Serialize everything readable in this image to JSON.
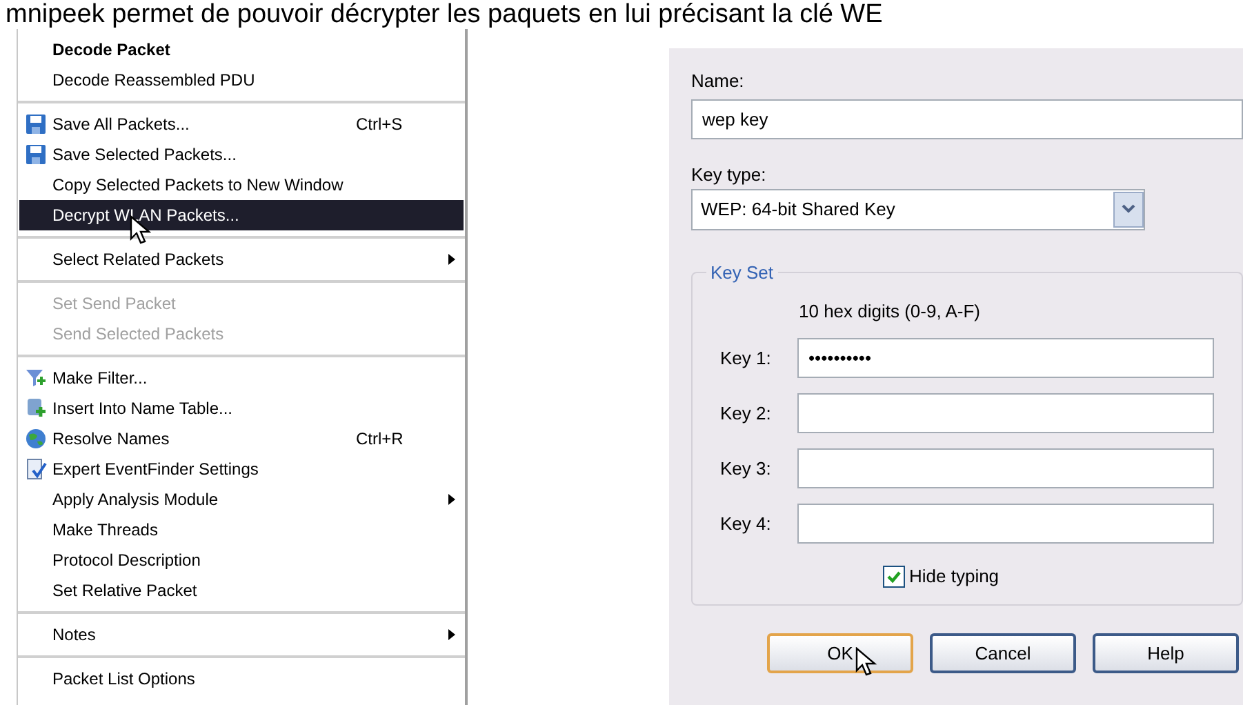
{
  "caption": "mnipeek permet de pouvoir décrypter les paquets en lui précisant la clé WE",
  "menu": [
    {
      "kind": "item",
      "label": "Decode Packet",
      "bold": true,
      "disabled": false,
      "selected": false,
      "submenu": false,
      "cursor": false
    },
    {
      "kind": "item",
      "label": "Decode Reassembled PDU",
      "bold": false,
      "disabled": false,
      "selected": false,
      "submenu": false,
      "cursor": false
    },
    {
      "kind": "separator"
    },
    {
      "kind": "item",
      "label": "Save All Packets...",
      "shortcut": "Ctrl+S",
      "bold": false,
      "disabled": false,
      "selected": false,
      "submenu": false,
      "cursor": false
    },
    {
      "kind": "item",
      "label": "Save Selected Packets...",
      "bold": false,
      "disabled": false,
      "selected": false,
      "submenu": false,
      "cursor": false
    },
    {
      "kind": "item",
      "label": "Copy Selected Packets to New Window",
      "bold": false,
      "disabled": false,
      "selected": false,
      "submenu": false,
      "cursor": false
    },
    {
      "kind": "item",
      "label": "Decrypt WLAN Packets...",
      "bold": false,
      "disabled": false,
      "selected": true,
      "submenu": false,
      "cursor": true
    },
    {
      "kind": "separator"
    },
    {
      "kind": "item",
      "label": "Select Related Packets",
      "bold": false,
      "disabled": false,
      "selected": false,
      "submenu": true,
      "cursor": false
    },
    {
      "kind": "separator"
    },
    {
      "kind": "item",
      "label": "Set Send Packet",
      "bold": false,
      "disabled": true,
      "selected": false,
      "submenu": false,
      "cursor": false
    },
    {
      "kind": "item",
      "label": "Send Selected Packets",
      "bold": false,
      "disabled": true,
      "selected": false,
      "submenu": false,
      "cursor": false
    },
    {
      "kind": "separator"
    },
    {
      "kind": "item",
      "label": "Make Filter...",
      "bold": false,
      "disabled": false,
      "selected": false,
      "submenu": false,
      "cursor": false
    },
    {
      "kind": "item",
      "label": "Insert Into Name Table...",
      "bold": false,
      "disabled": false,
      "selected": false,
      "submenu": false,
      "cursor": false
    },
    {
      "kind": "item",
      "label": "Resolve Names",
      "shortcut": "Ctrl+R",
      "bold": false,
      "disabled": false,
      "selected": false,
      "submenu": false,
      "cursor": false
    },
    {
      "kind": "item",
      "label": "Expert EventFinder Settings",
      "bold": false,
      "disabled": false,
      "selected": false,
      "submenu": false,
      "cursor": false
    },
    {
      "kind": "item",
      "label": "Apply Analysis Module",
      "bold": false,
      "disabled": false,
      "selected": false,
      "submenu": true,
      "cursor": false
    },
    {
      "kind": "item",
      "label": "Make Threads",
      "bold": false,
      "disabled": false,
      "selected": false,
      "submenu": false,
      "cursor": false
    },
    {
      "kind": "item",
      "label": "Protocol Description",
      "bold": false,
      "disabled": false,
      "selected": false,
      "submenu": false,
      "cursor": false
    },
    {
      "kind": "item",
      "label": "Set Relative Packet",
      "bold": false,
      "disabled": false,
      "selected": false,
      "submenu": false,
      "cursor": false
    },
    {
      "kind": "separator"
    },
    {
      "kind": "item",
      "label": "Notes",
      "bold": false,
      "disabled": false,
      "selected": false,
      "submenu": true,
      "cursor": false
    },
    {
      "kind": "separator"
    },
    {
      "kind": "item",
      "label": "Packet List Options",
      "bold": false,
      "disabled": false,
      "selected": false,
      "submenu": false,
      "cursor": false
    }
  ],
  "dialog": {
    "name_label": "Name:",
    "name_value": "wep key",
    "key_type_label": "Key type:",
    "key_type_value": "WEP: 64-bit Shared Key",
    "group_title": "Key Set",
    "hint": "10 hex digits (0-9, A-F)",
    "keys": [
      {
        "label": "Key 1:",
        "value": "••••••••••"
      },
      {
        "label": "Key 2:"
      },
      {
        "label": "Key 3:"
      },
      {
        "label": "Key 4:"
      }
    ],
    "hide_typing": {
      "label": "Hide typing",
      "checked": true
    },
    "buttons": [
      {
        "label": "OK",
        "focused": true,
        "cursor": true
      },
      {
        "label": "Cancel",
        "focused": false,
        "cursor": false
      },
      {
        "label": "Help",
        "focused": false,
        "cursor": false
      }
    ]
  }
}
